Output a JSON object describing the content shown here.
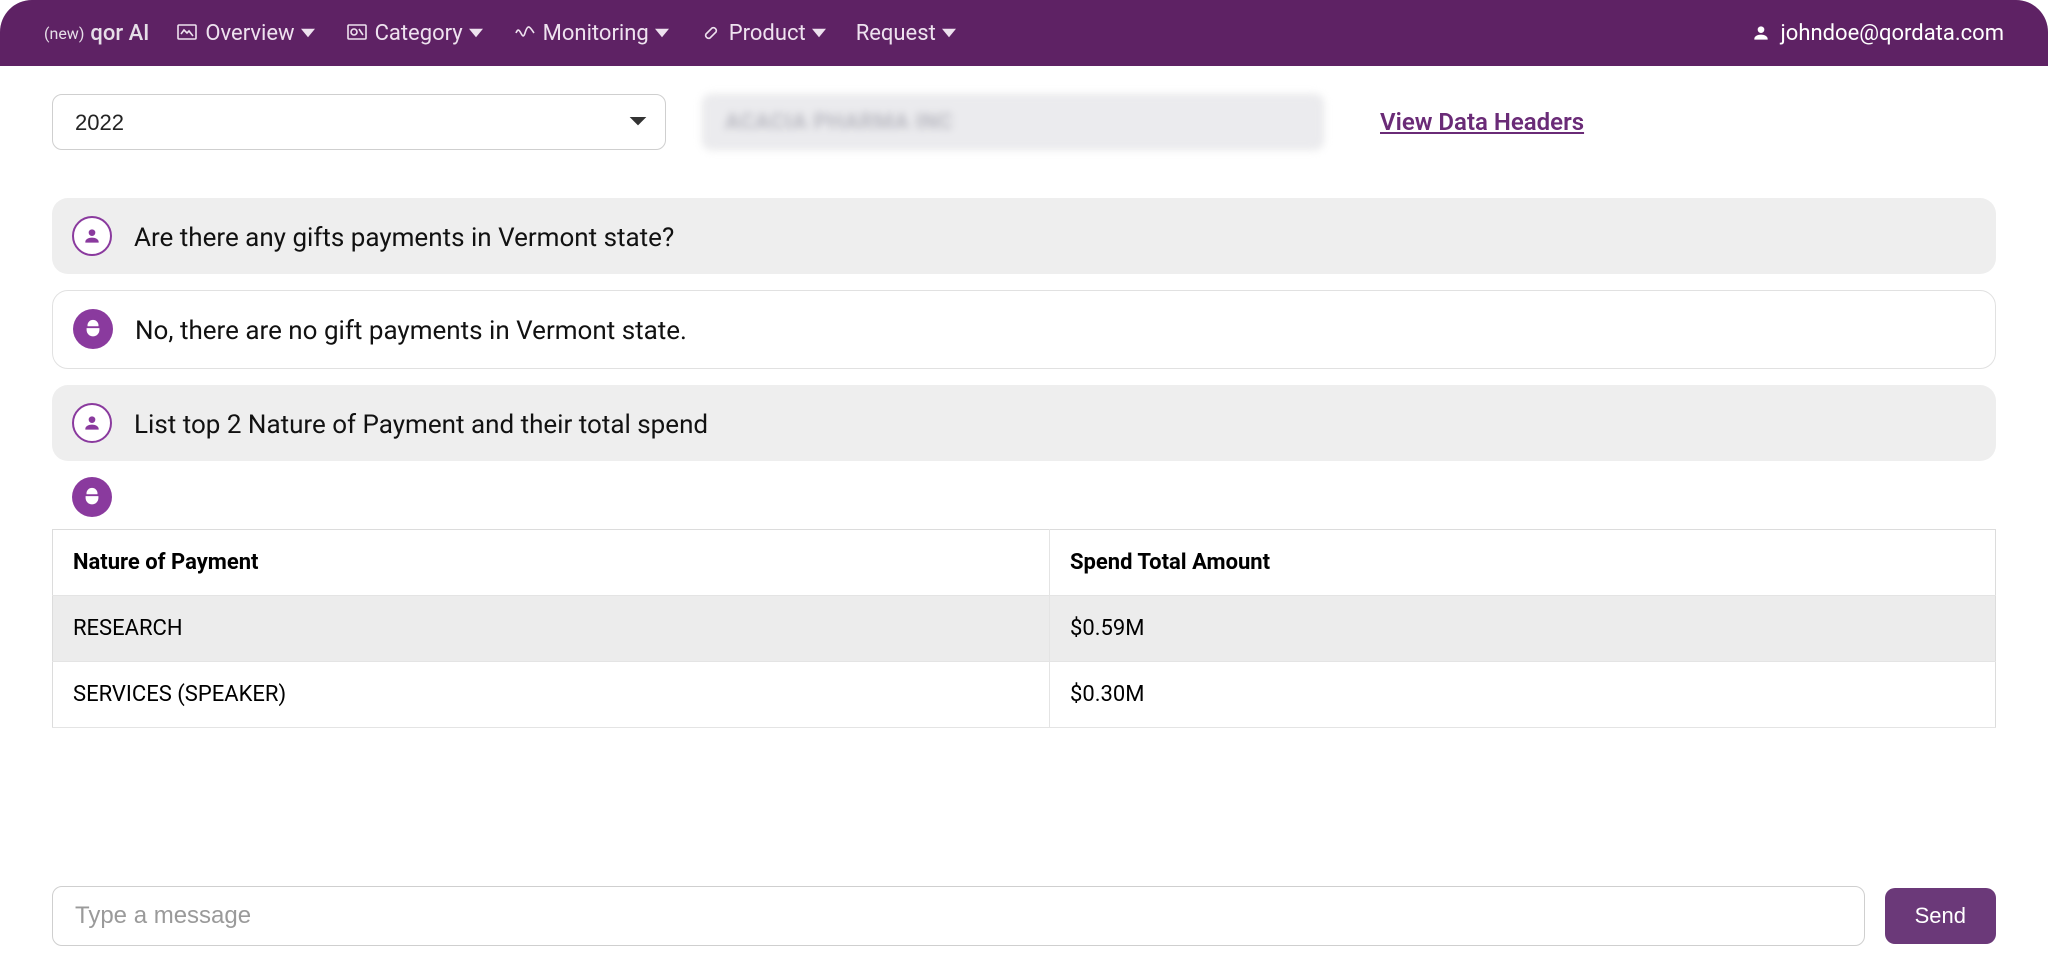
{
  "navbar": {
    "brand_prefix": "(new)",
    "brand_name": "qor AI",
    "items": [
      {
        "label": "Overview"
      },
      {
        "label": "Category"
      },
      {
        "label": "Monitoring"
      },
      {
        "label": "Product"
      },
      {
        "label": "Request"
      }
    ],
    "user_email": "johndoe@qordata.com"
  },
  "filters": {
    "year": "2022",
    "company_blurred": "ACACIA PHARMA INC",
    "headers_link": "View Data Headers"
  },
  "chat": {
    "q1": "Are there any gifts payments in Vermont state?",
    "a1": "No, there are no gift payments in Vermont state.",
    "q2": "List top 2 Nature of Payment and their total spend"
  },
  "table": {
    "cols": [
      "Nature of Payment",
      "Spend Total Amount"
    ],
    "rows": [
      {
        "nature": "RESEARCH",
        "amount": "$0.59M"
      },
      {
        "nature": "SERVICES (SPEAKER)",
        "amount": "$0.30M"
      }
    ]
  },
  "composer": {
    "placeholder": "Type a message",
    "send_label": "Send"
  }
}
